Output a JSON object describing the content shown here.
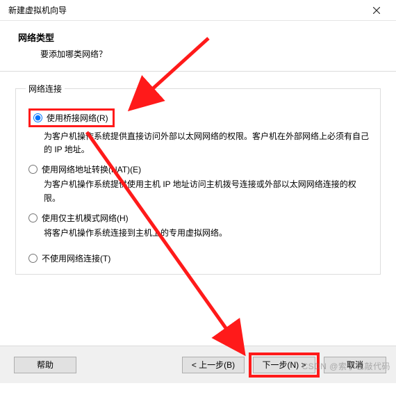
{
  "titlebar": {
    "title": "新建虚拟机向导"
  },
  "header": {
    "title": "网络类型",
    "subtitle": "要添加哪类网络？"
  },
  "group": {
    "legend": "网络连接",
    "options": [
      {
        "label": "使用桥接网络(R)",
        "desc": "为客户机操作系统提供直接访问外部以太网网络的权限。客户机在外部网络上必须有自己的 IP 地址。",
        "checked": true
      },
      {
        "label": "使用网络地址转换(NAT)(E)",
        "desc": "为客户机操作系统提供使用主机 IP 地址访问主机拨号连接或外部以太网网络连接的权限。",
        "checked": false
      },
      {
        "label": "使用仅主机模式网络(H)",
        "desc": "将客户机操作系统连接到主机上的专用虚拟网络。",
        "checked": false
      },
      {
        "label": "不使用网络连接(T)",
        "desc": "",
        "checked": false
      }
    ]
  },
  "footer": {
    "help": "帮助",
    "back": "< 上一步(B)",
    "next": "下一步(N) >",
    "cancel": "取消"
  },
  "watermark": "CSDN @索子也敲代码",
  "annotation": {
    "color": "#ff1a1a",
    "highlights": [
      "option-bridged",
      "next-button"
    ]
  }
}
